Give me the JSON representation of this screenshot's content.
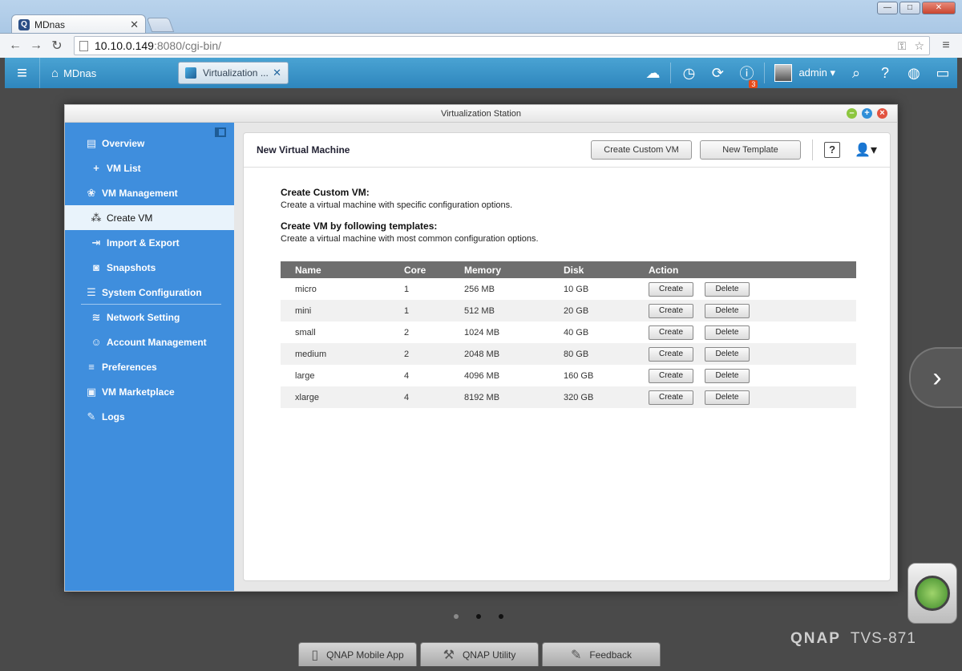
{
  "browser": {
    "tab_title": "MDnas",
    "favicon": "Q",
    "url_host": "10.10.0.149",
    "url_rest": ":8080/cgi-bin/"
  },
  "qts": {
    "home_label": "MDnas",
    "app_tab_label": "Virtualization ...",
    "notification_count": "3",
    "username": "admin"
  },
  "window": {
    "title": "Virtualization Station"
  },
  "sidebar": {
    "items": [
      {
        "label": "Overview"
      },
      {
        "label": "VM List"
      },
      {
        "label": "VM Management"
      },
      {
        "label": "Create VM"
      },
      {
        "label": "Import & Export"
      },
      {
        "label": "Snapshots"
      },
      {
        "label": "System Configuration"
      },
      {
        "label": "Network Setting"
      },
      {
        "label": "Account Management"
      },
      {
        "label": "Preferences"
      },
      {
        "label": "VM Marketplace"
      },
      {
        "label": "Logs"
      }
    ]
  },
  "main": {
    "title": "New Virtual Machine",
    "create_custom_btn": "Create Custom VM",
    "new_template_btn": "New Template",
    "help_label": "?",
    "custom_heading": "Create Custom VM:",
    "custom_desc": "Create a virtual machine with specific configuration options.",
    "template_heading": "Create VM by following templates:",
    "template_desc": "Create a virtual machine with most common configuration options.",
    "table": {
      "headers": [
        "Name",
        "Core",
        "Memory",
        "Disk",
        "Action"
      ],
      "create_label": "Create",
      "delete_label": "Delete",
      "rows": [
        {
          "name": "micro",
          "core": "1",
          "memory": "256 MB",
          "disk": "10 GB"
        },
        {
          "name": "mini",
          "core": "1",
          "memory": "512 MB",
          "disk": "20 GB"
        },
        {
          "name": "small",
          "core": "2",
          "memory": "1024 MB",
          "disk": "40 GB"
        },
        {
          "name": "medium",
          "core": "2",
          "memory": "2048 MB",
          "disk": "80 GB"
        },
        {
          "name": "large",
          "core": "4",
          "memory": "4096 MB",
          "disk": "160 GB"
        },
        {
          "name": "xlarge",
          "core": "4",
          "memory": "8192 MB",
          "disk": "320 GB"
        }
      ]
    }
  },
  "desktop": {
    "brand": "QNAP",
    "model": "TVS-871",
    "dock": [
      "QNAP Mobile App",
      "QNAP Utility",
      "Feedback"
    ]
  }
}
